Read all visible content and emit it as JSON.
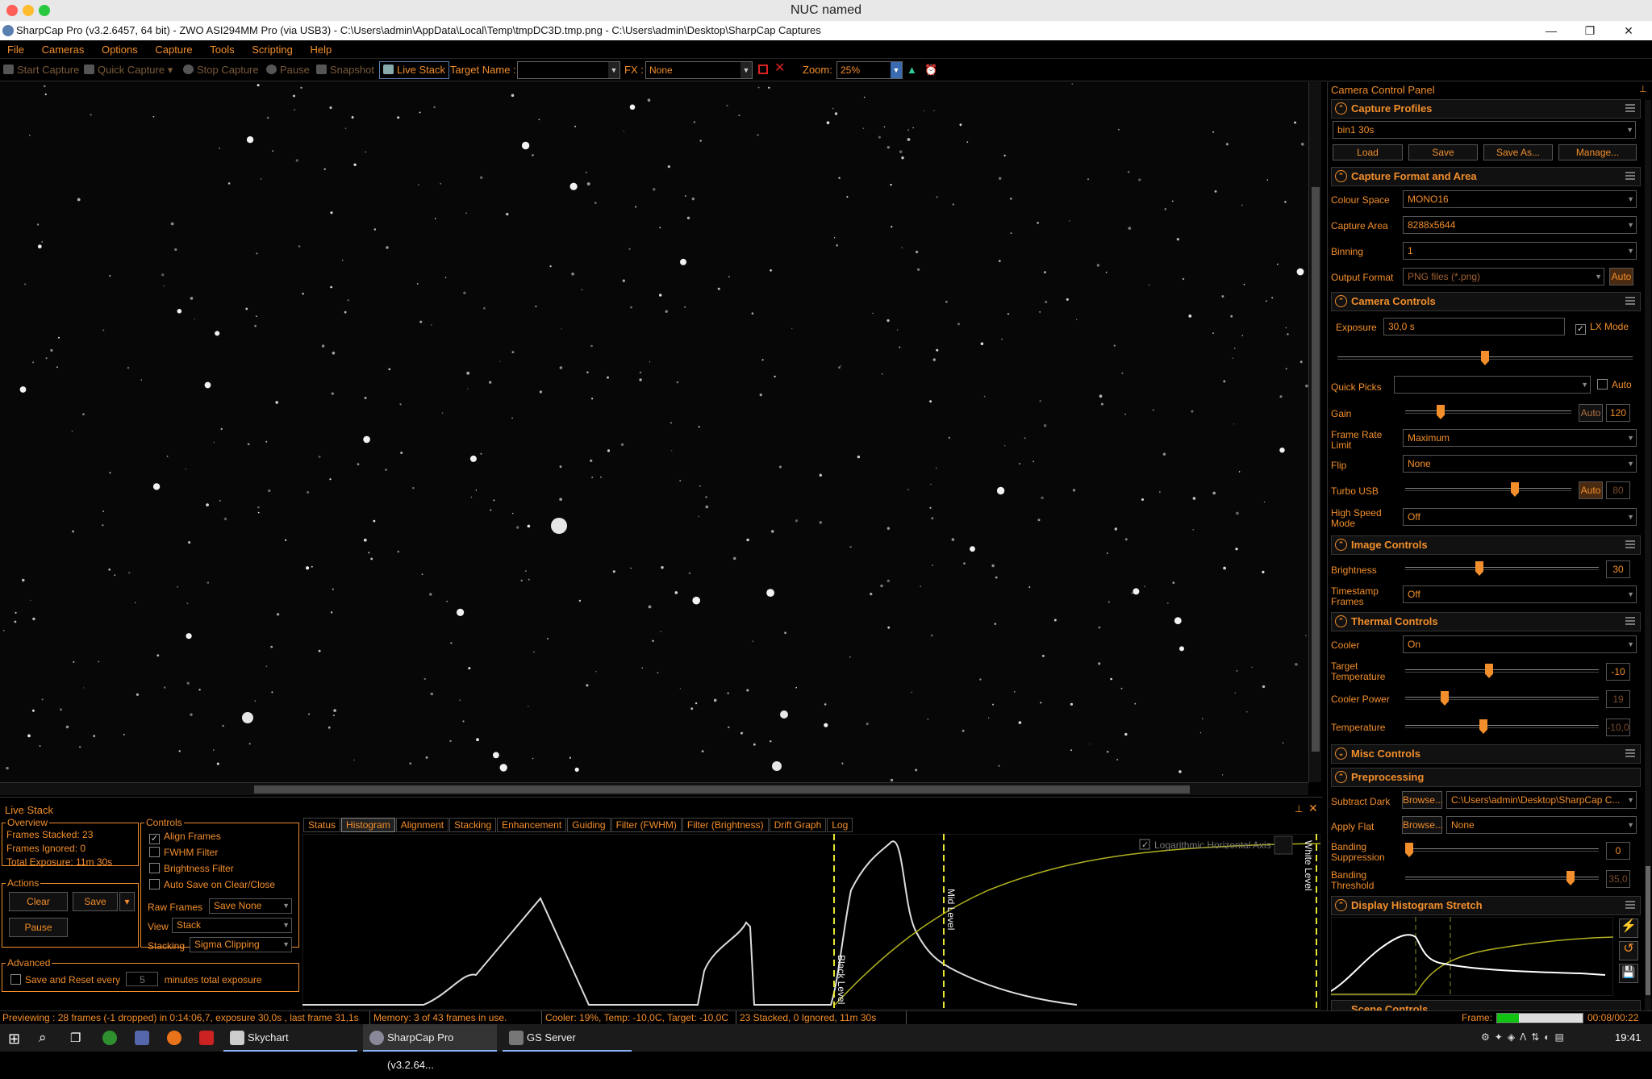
{
  "window": {
    "title": "NUC named"
  },
  "app": {
    "title": "SharpCap Pro (v3.2.6457, 64 bit) - ZWO ASI294MM Pro (via USB3) - C:\\Users\\admin\\AppData\\Local\\Temp\\tmpDC3D.tmp.png - C:\\Users\\admin\\Desktop\\SharpCap Captures"
  },
  "menu": [
    "File",
    "Cameras",
    "Options",
    "Capture",
    "Tools",
    "Scripting",
    "Help"
  ],
  "toolbar": {
    "start_capture": "Start Capture",
    "quick_capture": "Quick Capture",
    "stop_capture": "Stop Capture",
    "pause": "Pause",
    "snapshot": "Snapshot",
    "live_stack": "Live Stack",
    "target_name_label": "Target Name :",
    "target_name_value": "",
    "fx_label": "FX :",
    "fx_value": "None",
    "zoom_label": "Zoom:",
    "zoom_value": "25%"
  },
  "panel": {
    "title": "Camera Control Panel",
    "capture_profiles": {
      "title": "Capture Profiles",
      "profile": "bin1 30s",
      "load": "Load",
      "save": "Save",
      "save_as": "Save As...",
      "manage": "Manage..."
    },
    "capture_format": {
      "title": "Capture Format and Area",
      "colour_space_label": "Colour Space",
      "colour_space": "MONO16",
      "capture_area_label": "Capture Area",
      "capture_area": "8288x5644",
      "binning_label": "Binning",
      "binning": "1",
      "output_format_label": "Output Format",
      "output_format": "PNG files (*.png)",
      "auto": "Auto"
    },
    "camera_controls": {
      "title": "Camera Controls",
      "exposure_label": "Exposure",
      "exposure": "30,0 s",
      "lx_mode": "LX Mode",
      "quick_picks_label": "Quick Picks",
      "auto": "Auto",
      "gain_label": "Gain",
      "gain_auto": "Auto",
      "gain": "120",
      "gain_level": 0.2,
      "exposure_level": 0.5,
      "frame_rate_label": "Frame Rate Limit",
      "frame_rate": "Maximum",
      "flip_label": "Flip",
      "flip": "None",
      "turbo_label": "Turbo USB",
      "turbo_auto": "Auto",
      "turbo": "80",
      "turbo_level": 0.67,
      "hs_label": "High Speed Mode",
      "hs": "Off"
    },
    "image_controls": {
      "title": "Image Controls",
      "brightness_label": "Brightness",
      "brightness": "30",
      "brightness_level": 0.38,
      "timestamp_label": "Timestamp Frames",
      "timestamp": "Off"
    },
    "thermal": {
      "title": "Thermal Controls",
      "cooler_label": "Cooler",
      "cooler": "On",
      "target_label": "Target Temperature",
      "target": "-10",
      "target_level": 0.43,
      "power_label": "Cooler Power",
      "power": "19",
      "power_level": 0.19,
      "temp_label": "Temperature",
      "temp": "-10,0",
      "temp_level": 0.4
    },
    "misc": {
      "title": "Misc Controls"
    },
    "preprocessing": {
      "title": "Preprocessing",
      "subtract_dark_label": "Subtract Dark",
      "browse": "Browse...",
      "dark_path": "C:\\Users\\admin\\Desktop\\SharpCap C...",
      "apply_flat_label": "Apply Flat",
      "flat": "None",
      "banding_sup_label": "Banding Suppression",
      "banding_sup": "0",
      "banding_sup_level": 0.0,
      "banding_thr_label": "Banding Threshold",
      "banding_thr": "35,0",
      "banding_thr_level": 0.87
    },
    "histogram_stretch": {
      "title": "Display Histogram Stretch"
    },
    "scene_controls": {
      "title": "Scene Controls"
    }
  },
  "livestack": {
    "title": "Live Stack",
    "overview_title": "Overview",
    "frames_stacked": "Frames Stacked:  23",
    "frames_ignored": "Frames Ignored:   0",
    "total_exposure": "Total Exposure:   11m 30s",
    "actions_title": "Actions",
    "clear": "Clear",
    "save": "Save",
    "pause": "Pause",
    "controls_title": "Controls",
    "align_frames": "Align Frames",
    "fwhm_filter": "FWHM Filter",
    "brightness_filter": "Brightness Filter",
    "auto_save": "Auto Save on Clear/Close",
    "raw_frames_label": "Raw Frames",
    "raw_frames": "Save None",
    "view_label": "View",
    "view": "Stack",
    "stacking_label": "Stacking",
    "stacking": "Sigma Clipping",
    "advanced_title": "Advanced",
    "save_reset_pre": "Save and Reset every",
    "save_reset_value": "5",
    "save_reset_post": "minutes total exposure",
    "tabs": [
      "Status",
      "Histogram",
      "Alignment",
      "Stacking",
      "Enhancement",
      "Guiding",
      "Filter (FWHM)",
      "Filter (Brightness)",
      "Drift Graph",
      "Log"
    ],
    "log_axis": "Logarithmic Horizontal Axis",
    "black_level": "Black Level",
    "mid_level": "Mid Level",
    "white_level": "White Level"
  },
  "status": {
    "preview": "Previewing : 28 frames (-1 dropped) in 0:14:06,7, exposure 30,0s , last frame 31,1s",
    "memory": "Memory: 3 of 43 frames in use.",
    "cooler": "Cooler: 19%, Temp: -10,0C, Target: -10,0C",
    "stacked": "23 Stacked, 0 Ignored, 11m 30s",
    "frame_label": "Frame:",
    "frame_progress": 0.25,
    "frame_time": "00:08/00:22"
  },
  "taskbar": {
    "skychart": "Skychart",
    "sharpcap": "SharpCap Pro (v3.2.64...",
    "gs_server": "GS Server",
    "clock": "19:41"
  },
  "colors": {
    "accent": "#f28e2b",
    "background": "#000000",
    "level_line": "#e6e632"
  }
}
